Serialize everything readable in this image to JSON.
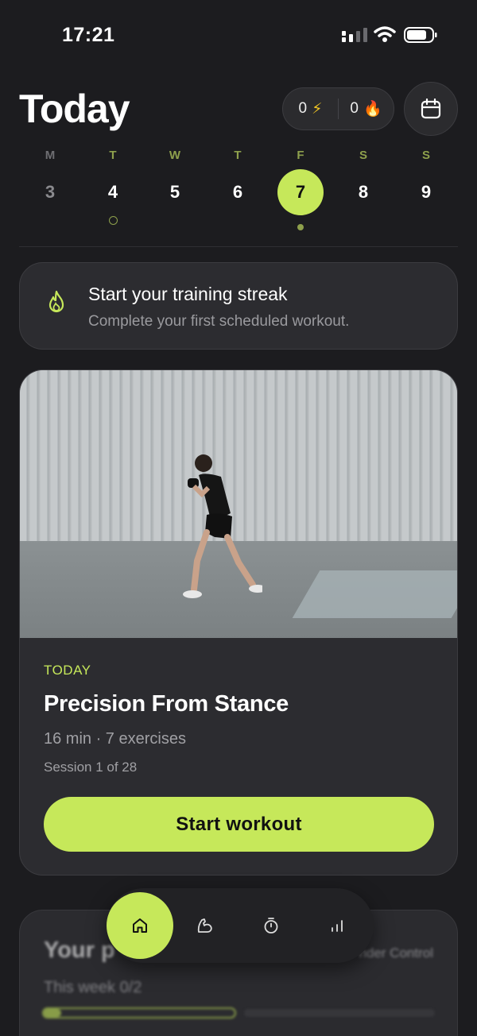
{
  "status_bar": {
    "time": "17:21"
  },
  "header": {
    "title": "Today",
    "stats": [
      {
        "value": "0",
        "icon": "lightning-icon",
        "glyph": "⚡"
      },
      {
        "value": "0",
        "icon": "fire-icon",
        "glyph": "🔥"
      }
    ],
    "calendar_icon": "calendar-icon"
  },
  "week": {
    "days": [
      {
        "letter": "M",
        "number": "3"
      },
      {
        "letter": "T",
        "number": "4"
      },
      {
        "letter": "W",
        "number": "5"
      },
      {
        "letter": "T",
        "number": "6"
      },
      {
        "letter": "F",
        "number": "7"
      },
      {
        "letter": "S",
        "number": "8"
      },
      {
        "letter": "S",
        "number": "9"
      }
    ]
  },
  "streak_card": {
    "title": "Start your training streak",
    "subtitle": "Complete your first scheduled workout."
  },
  "workout_card": {
    "tag": "TODAY",
    "title": "Precision From Stance",
    "meta": "16 min · 7 exercises",
    "session": "Session 1 of 28",
    "button": "Start workout"
  },
  "plan_card": {
    "title": "Your p",
    "right_label": "nder Control",
    "week_label": "This week   0/2",
    "progress_fraction": 0.0
  },
  "tab_bar": {
    "tabs": [
      "home-icon",
      "muscle-icon",
      "timer-icon",
      "stats-icon"
    ]
  },
  "colors": {
    "accent": "#c6e85a",
    "background": "#1c1c1f",
    "card": "#2c2c30"
  }
}
